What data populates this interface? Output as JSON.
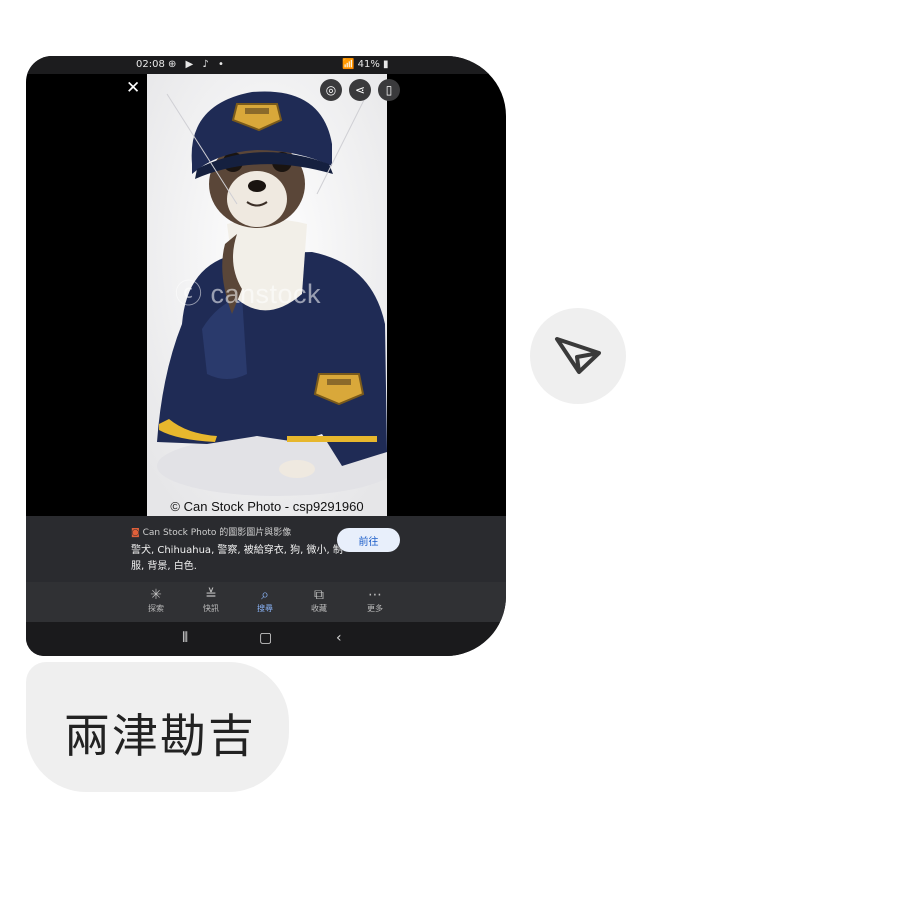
{
  "screenshot": {
    "status_bar": {
      "time": "02:08",
      "right": "41%"
    },
    "image_credit": "© Can Stock Photo - csp9291960",
    "watermark": "canstock",
    "info_panel": {
      "source": "Can Stock Photo 的圖影圖片與影像",
      "tags": "警犬, Chihuahua, 警察, 被給穿衣, 狗, 微小, 制服, 背景, 白色.",
      "goto_label": "前往"
    },
    "bottom_nav": [
      {
        "label": "探索",
        "icon": "asterisk-icon"
      },
      {
        "label": "快訊",
        "icon": "updates-icon"
      },
      {
        "label": "搜尋",
        "icon": "search-icon",
        "active": true
      },
      {
        "label": "收藏",
        "icon": "collections-icon"
      },
      {
        "label": "更多",
        "icon": "more-icon"
      }
    ]
  },
  "message": {
    "text": "兩津勘吉"
  },
  "colors": {
    "accent_blue": "#8ab4f8",
    "bubble_gray": "#efefef"
  }
}
